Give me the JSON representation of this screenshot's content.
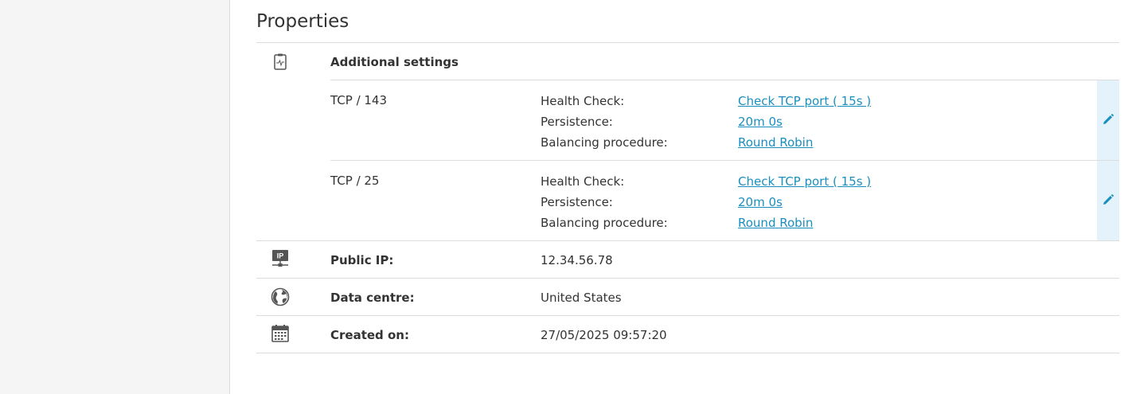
{
  "title": "Properties",
  "additional": {
    "label": "Additional settings",
    "rules": [
      {
        "name": "TCP / 143",
        "items": [
          {
            "key": "Health Check:",
            "value": "Check TCP port ( 15s )"
          },
          {
            "key": "Persistence:",
            "value": "20m 0s"
          },
          {
            "key": "Balancing procedure:",
            "value": "Round Robin"
          }
        ]
      },
      {
        "name": "TCP / 25",
        "items": [
          {
            "key": "Health Check:",
            "value": "Check TCP port ( 15s )"
          },
          {
            "key": "Persistence:",
            "value": "20m 0s"
          },
          {
            "key": "Balancing procedure:",
            "value": "Round Robin"
          }
        ]
      }
    ]
  },
  "public_ip": {
    "label": "Public IP:",
    "value": "12.34.56.78",
    "icon_text": "IP"
  },
  "data_centre": {
    "label": "Data centre:",
    "value": "United States"
  },
  "created_on": {
    "label": "Created on:",
    "value": "27/05/2025 09:57:20"
  },
  "colors": {
    "link": "#1a8fbf",
    "edit_bg": "#e4f3fb"
  },
  "icons": {
    "settings": "clipboard-pulse-icon",
    "edit": "pencil-icon",
    "ip": "network-ip-icon",
    "datacentre": "globe-icon",
    "created": "calendar-icon"
  }
}
